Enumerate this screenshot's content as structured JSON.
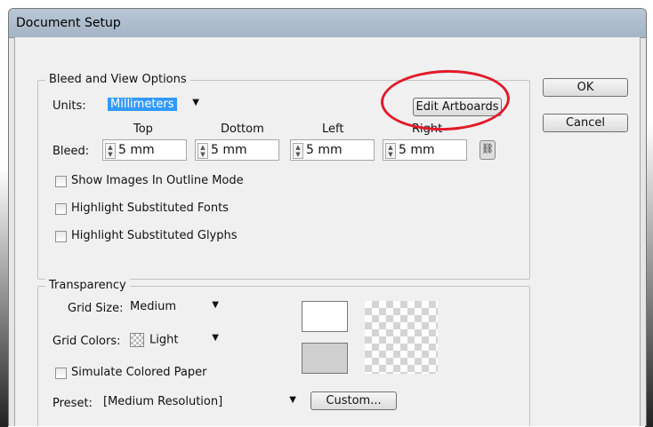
{
  "window": {
    "title": "Document Setup"
  },
  "bleed_group": {
    "legend": "Bleed and View Options",
    "units_label": "Units:",
    "units_value": "Millimeters",
    "edit_artboards": "Edit Artboards",
    "bleed_label": "Bleed:",
    "headers": {
      "top": "Top",
      "bottom": "Dottom",
      "left": "Left",
      "right": "Right"
    },
    "values": {
      "top": "5 mm",
      "bottom": "5 mm",
      "left": "5 mm",
      "right": "5 mm"
    },
    "options": [
      "Show Images In Outline Mode",
      "Highlight Substituted Fonts",
      "Highlight Substituted Glyphs"
    ]
  },
  "transparency_group": {
    "legend": "Transparency",
    "grid_size_label": "Grid Size:",
    "grid_size_value": "Medium",
    "grid_colors_label": "Grid Colors:",
    "grid_colors_value": "Light",
    "simulate_paper": "Simulate Colored Paper",
    "preset_label": "Preset:",
    "preset_value": "[Medium Resolution]",
    "custom": "Custom..."
  },
  "buttons": {
    "ok": "OK",
    "cancel": "Cancel"
  },
  "icons": {
    "dropdown": "chevron-down-icon",
    "spinner": "spinner-icon",
    "link": "link-icon"
  },
  "colors": {
    "annotation": "#e21a2a",
    "selection": "#3399ff",
    "titlebar": "#aebdcc"
  }
}
